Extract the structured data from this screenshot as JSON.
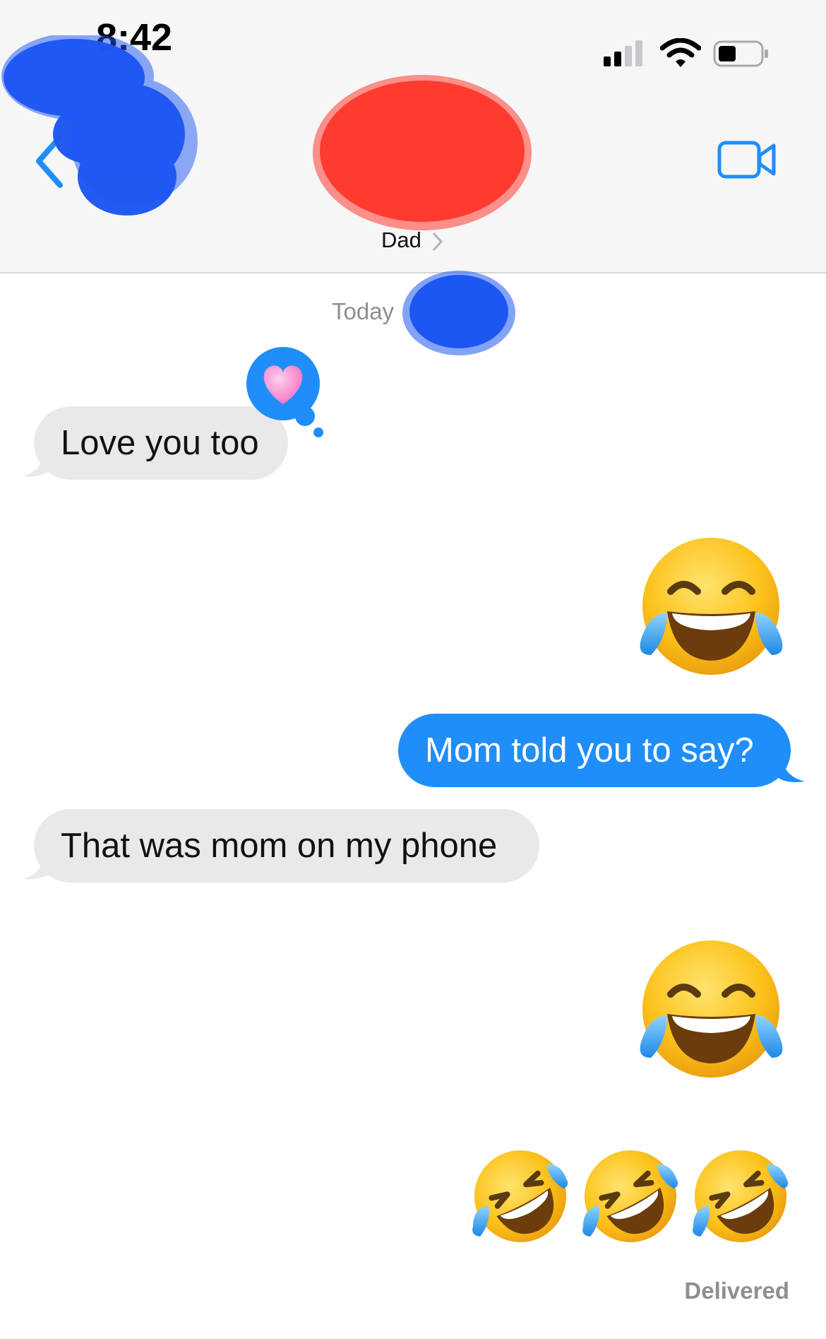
{
  "status_bar": {
    "time": "8:42"
  },
  "header": {
    "contact_name": "Dad"
  },
  "conversation": {
    "date_label": "Today",
    "messages": [
      {
        "side": "received",
        "text": "Love you too",
        "reaction": "heart"
      },
      {
        "side": "sent",
        "emoji": "joy",
        "count": 1
      },
      {
        "side": "sent",
        "text": "Mom told you to say?"
      },
      {
        "side": "received",
        "text": "That was mom on my phone"
      },
      {
        "side": "sent",
        "emoji": "joy",
        "count": 1
      },
      {
        "side": "sent",
        "emoji": "rofl",
        "count": 3
      }
    ],
    "status": "Delivered"
  },
  "colors": {
    "accent": "#1f8ef8",
    "received_bubble": "#e9e9eb",
    "sent_bubble": "#1f8ef8",
    "redaction_blue": "#1d57f2",
    "redaction_red": "#ff3b30"
  }
}
